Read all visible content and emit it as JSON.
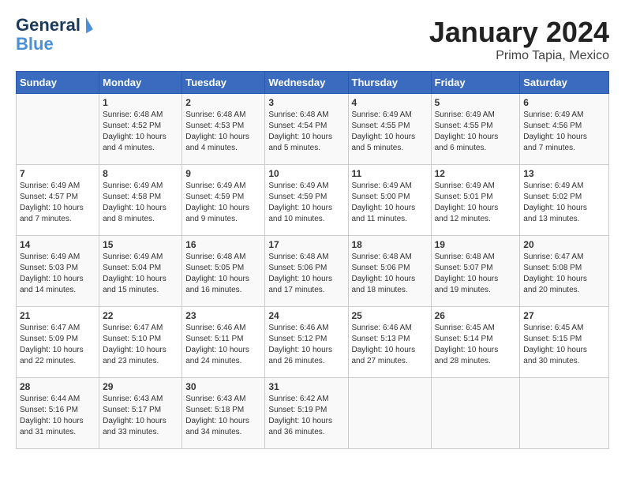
{
  "header": {
    "logo_line1": "General",
    "logo_line2": "Blue",
    "title": "January 2024",
    "subtitle": "Primo Tapia, Mexico"
  },
  "calendar": {
    "days_of_week": [
      "Sunday",
      "Monday",
      "Tuesday",
      "Wednesday",
      "Thursday",
      "Friday",
      "Saturday"
    ],
    "weeks": [
      [
        {
          "day": "",
          "info": ""
        },
        {
          "day": "1",
          "info": "Sunrise: 6:48 AM\nSunset: 4:52 PM\nDaylight: 10 hours\nand 4 minutes."
        },
        {
          "day": "2",
          "info": "Sunrise: 6:48 AM\nSunset: 4:53 PM\nDaylight: 10 hours\nand 4 minutes."
        },
        {
          "day": "3",
          "info": "Sunrise: 6:48 AM\nSunset: 4:54 PM\nDaylight: 10 hours\nand 5 minutes."
        },
        {
          "day": "4",
          "info": "Sunrise: 6:49 AM\nSunset: 4:55 PM\nDaylight: 10 hours\nand 5 minutes."
        },
        {
          "day": "5",
          "info": "Sunrise: 6:49 AM\nSunset: 4:55 PM\nDaylight: 10 hours\nand 6 minutes."
        },
        {
          "day": "6",
          "info": "Sunrise: 6:49 AM\nSunset: 4:56 PM\nDaylight: 10 hours\nand 7 minutes."
        }
      ],
      [
        {
          "day": "7",
          "info": "Sunrise: 6:49 AM\nSunset: 4:57 PM\nDaylight: 10 hours\nand 7 minutes."
        },
        {
          "day": "8",
          "info": "Sunrise: 6:49 AM\nSunset: 4:58 PM\nDaylight: 10 hours\nand 8 minutes."
        },
        {
          "day": "9",
          "info": "Sunrise: 6:49 AM\nSunset: 4:59 PM\nDaylight: 10 hours\nand 9 minutes."
        },
        {
          "day": "10",
          "info": "Sunrise: 6:49 AM\nSunset: 4:59 PM\nDaylight: 10 hours\nand 10 minutes."
        },
        {
          "day": "11",
          "info": "Sunrise: 6:49 AM\nSunset: 5:00 PM\nDaylight: 10 hours\nand 11 minutes."
        },
        {
          "day": "12",
          "info": "Sunrise: 6:49 AM\nSunset: 5:01 PM\nDaylight: 10 hours\nand 12 minutes."
        },
        {
          "day": "13",
          "info": "Sunrise: 6:49 AM\nSunset: 5:02 PM\nDaylight: 10 hours\nand 13 minutes."
        }
      ],
      [
        {
          "day": "14",
          "info": "Sunrise: 6:49 AM\nSunset: 5:03 PM\nDaylight: 10 hours\nand 14 minutes."
        },
        {
          "day": "15",
          "info": "Sunrise: 6:49 AM\nSunset: 5:04 PM\nDaylight: 10 hours\nand 15 minutes."
        },
        {
          "day": "16",
          "info": "Sunrise: 6:48 AM\nSunset: 5:05 PM\nDaylight: 10 hours\nand 16 minutes."
        },
        {
          "day": "17",
          "info": "Sunrise: 6:48 AM\nSunset: 5:06 PM\nDaylight: 10 hours\nand 17 minutes."
        },
        {
          "day": "18",
          "info": "Sunrise: 6:48 AM\nSunset: 5:06 PM\nDaylight: 10 hours\nand 18 minutes."
        },
        {
          "day": "19",
          "info": "Sunrise: 6:48 AM\nSunset: 5:07 PM\nDaylight: 10 hours\nand 19 minutes."
        },
        {
          "day": "20",
          "info": "Sunrise: 6:47 AM\nSunset: 5:08 PM\nDaylight: 10 hours\nand 20 minutes."
        }
      ],
      [
        {
          "day": "21",
          "info": "Sunrise: 6:47 AM\nSunset: 5:09 PM\nDaylight: 10 hours\nand 22 minutes."
        },
        {
          "day": "22",
          "info": "Sunrise: 6:47 AM\nSunset: 5:10 PM\nDaylight: 10 hours\nand 23 minutes."
        },
        {
          "day": "23",
          "info": "Sunrise: 6:46 AM\nSunset: 5:11 PM\nDaylight: 10 hours\nand 24 minutes."
        },
        {
          "day": "24",
          "info": "Sunrise: 6:46 AM\nSunset: 5:12 PM\nDaylight: 10 hours\nand 26 minutes."
        },
        {
          "day": "25",
          "info": "Sunrise: 6:46 AM\nSunset: 5:13 PM\nDaylight: 10 hours\nand 27 minutes."
        },
        {
          "day": "26",
          "info": "Sunrise: 6:45 AM\nSunset: 5:14 PM\nDaylight: 10 hours\nand 28 minutes."
        },
        {
          "day": "27",
          "info": "Sunrise: 6:45 AM\nSunset: 5:15 PM\nDaylight: 10 hours\nand 30 minutes."
        }
      ],
      [
        {
          "day": "28",
          "info": "Sunrise: 6:44 AM\nSunset: 5:16 PM\nDaylight: 10 hours\nand 31 minutes."
        },
        {
          "day": "29",
          "info": "Sunrise: 6:43 AM\nSunset: 5:17 PM\nDaylight: 10 hours\nand 33 minutes."
        },
        {
          "day": "30",
          "info": "Sunrise: 6:43 AM\nSunset: 5:18 PM\nDaylight: 10 hours\nand 34 minutes."
        },
        {
          "day": "31",
          "info": "Sunrise: 6:42 AM\nSunset: 5:19 PM\nDaylight: 10 hours\nand 36 minutes."
        },
        {
          "day": "",
          "info": ""
        },
        {
          "day": "",
          "info": ""
        },
        {
          "day": "",
          "info": ""
        }
      ]
    ]
  }
}
